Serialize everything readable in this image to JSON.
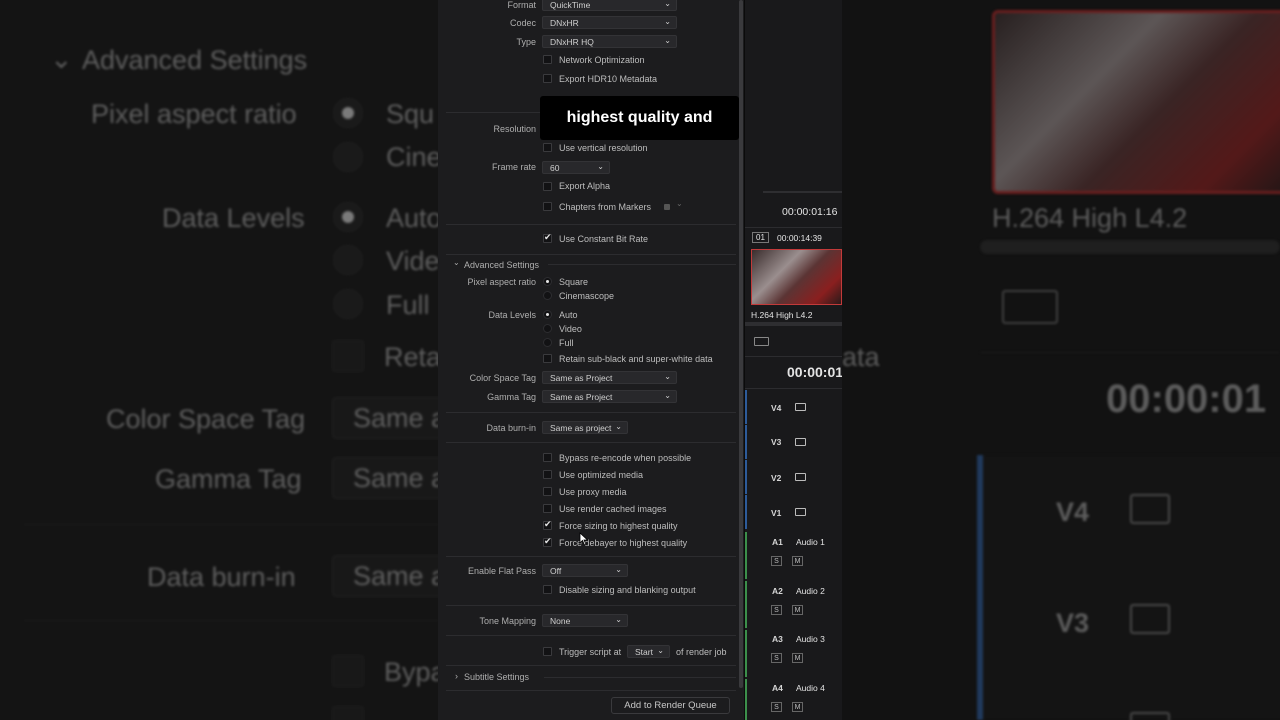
{
  "render_settings": {
    "format_label": "Format",
    "format_value": "QuickTime",
    "codec_label": "Codec",
    "codec_value": "DNxHR",
    "type_label": "Type",
    "type_value": "DNxHR HQ",
    "network_optimization": "Network Optimization",
    "export_hdr10": "Export HDR10 Metadata",
    "resolution_label": "Resolution",
    "use_vertical_resolution": "Use vertical resolution",
    "frame_rate_label": "Frame rate",
    "frame_rate_value": "60",
    "export_alpha": "Export Alpha",
    "chapters_from_markers": "Chapters from Markers",
    "use_constant_bit_rate": "Use Constant Bit Rate",
    "advanced_settings": "Advanced Settings",
    "pixel_aspect_label": "Pixel aspect ratio",
    "pixel_aspect_options": [
      "Square",
      "Cinemascope"
    ],
    "data_levels_label": "Data Levels",
    "data_levels_options": [
      "Auto",
      "Video",
      "Full"
    ],
    "retain_sub_black": "Retain sub-black and super-white data",
    "color_space_tag_label": "Color Space Tag",
    "color_space_tag_value": "Same as Project",
    "gamma_tag_label": "Gamma Tag",
    "gamma_tag_value": "Same as Project",
    "data_burn_in_label": "Data burn-in",
    "data_burn_in_value": "Same as project",
    "bypass_reencode": "Bypass re-encode when possible",
    "use_optimized_media": "Use optimized media",
    "use_proxy_media": "Use proxy media",
    "use_render_cached": "Use render cached images",
    "force_sizing": "Force sizing to highest quality",
    "force_debayer": "Force debayer to highest quality",
    "enable_flat_pass_label": "Enable Flat Pass",
    "enable_flat_pass_value": "Off",
    "disable_sizing": "Disable sizing and blanking output",
    "tone_mapping_label": "Tone Mapping",
    "tone_mapping_value": "None",
    "trigger_script_label": "Trigger script at",
    "trigger_script_value": "Start",
    "trigger_script_suffix": "of render job",
    "subtitle_settings": "Subtitle Settings",
    "add_to_render_queue": "Add to Render Queue"
  },
  "caption": "highest quality and",
  "timeline": {
    "timecode_top": "00:00:01:16",
    "clip_number": "01",
    "clip_duration": "00:00:14:39",
    "clip_codec": "H.264 High L4.2",
    "timecode_main": "00:00:01",
    "video_tracks": [
      "V4",
      "V3",
      "V2",
      "V1"
    ],
    "audio_tracks": [
      {
        "id": "A1",
        "name": "Audio 1"
      },
      {
        "id": "A2",
        "name": "Audio 2"
      },
      {
        "id": "A3",
        "name": "Audio 3"
      },
      {
        "id": "A4",
        "name": "Audio 4"
      }
    ],
    "solo": "S",
    "mute": "M"
  },
  "background_left": {
    "advanced_settings": "Advanced Settings",
    "pixel_aspect": "Pixel aspect ratio",
    "square_partial": "Squ",
    "cine_partial": "Cine",
    "data_levels": "Data Levels",
    "auto_partial": "Auto",
    "video_partial": "Vide",
    "full_partial": "Full",
    "retain_partial": "Reta",
    "color_space_tag": "Color Space Tag",
    "gamma_tag": "Gamma Tag",
    "same_as_partial": "Same a",
    "data_burn_in": "Data burn-in",
    "bypass_partial": "Bypa"
  },
  "background_right": {
    "codec": "H.264 High L4.2",
    "timecode": "00:00:01",
    "v4": "V4",
    "v3": "V3",
    "ata_partial": "ata"
  }
}
